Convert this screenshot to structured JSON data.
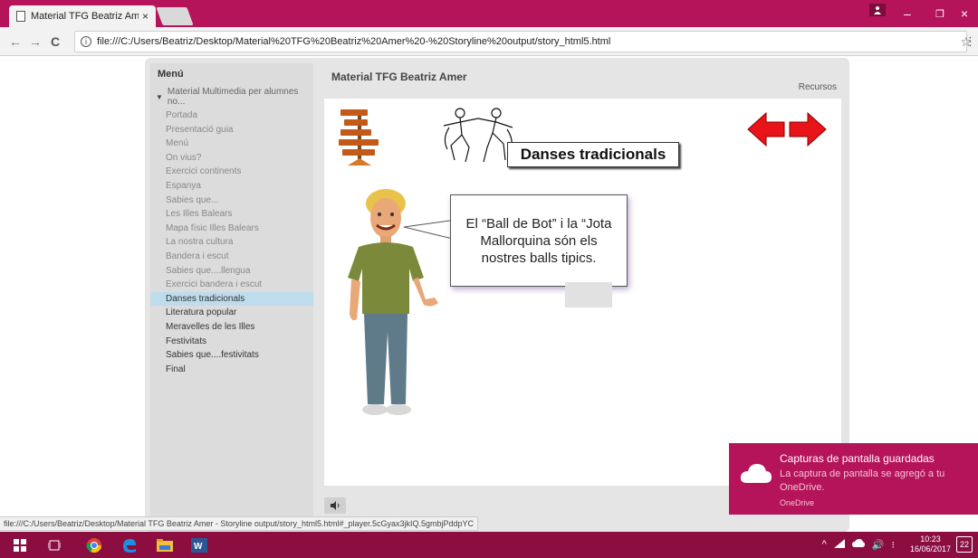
{
  "browser": {
    "tab_title": "Material TFG Beatriz Ame",
    "tab_close": "×",
    "url": "file:///C:/Users/Beatriz/Desktop/Material%20TFG%20Beatriz%20Amer%20-%20Storyline%20output/story_html5.html",
    "back": "←",
    "forward": "→",
    "reload": "C",
    "info": "i",
    "star": "☆",
    "menu_dots": "⋮",
    "minimize": "–",
    "restore": "❐",
    "close": "×"
  },
  "player": {
    "menu_heading": "Menú",
    "section_label": "Material Multimedia per alumnes no...",
    "menu_items": [
      {
        "label": "Portada",
        "state": "normal"
      },
      {
        "label": "Presentació guia",
        "state": "normal"
      },
      {
        "label": "Menú",
        "state": "normal"
      },
      {
        "label": "On vius?",
        "state": "normal"
      },
      {
        "label": "Exercici continents",
        "state": "normal"
      },
      {
        "label": "Espanya",
        "state": "normal"
      },
      {
        "label": "Sabies que...",
        "state": "normal"
      },
      {
        "label": "Les Illes Balears",
        "state": "normal"
      },
      {
        "label": "Mapa físic Illes Balears",
        "state": "normal"
      },
      {
        "label": "La nostra cultura",
        "state": "normal"
      },
      {
        "label": "Bandera i escut",
        "state": "normal"
      },
      {
        "label": "Sabies que....llengua",
        "state": "normal"
      },
      {
        "label": "Exercici bandera i escut",
        "state": "normal"
      },
      {
        "label": "Danses tradicionals",
        "state": "active"
      },
      {
        "label": "Literatura popular",
        "state": "visited"
      },
      {
        "label": "Meravelles de les Illes",
        "state": "visited"
      },
      {
        "label": "Festivitats",
        "state": "visited"
      },
      {
        "label": "Sabies que....festivitats",
        "state": "visited"
      },
      {
        "label": "Final",
        "state": "visited"
      }
    ],
    "course_title": "Material TFG Beatriz Amer",
    "resources_label": "Recursos",
    "slide": {
      "title": "Danses tradicionals",
      "bubble_text": "El “Ball de Bot” i la “Jota Mallorquina són els nostres balls tipics.",
      "sign_boards": [
        "",
        "",
        "",
        "",
        ""
      ]
    },
    "sound_icon": "🔈"
  },
  "status_url": "file:///C:/Users/Beatriz/Desktop/Material TFG Beatriz Amer - Storyline output/story_html5.html#_player.5cGyax3jkIQ.5gmbjPddpYC",
  "toast": {
    "title": "Capturas de pantalla guardadas",
    "body": "La captura de pantalla se agregó a tu OneDrive.",
    "source": "OneDrive"
  },
  "taskbar": {
    "time": "10:23",
    "date": "16/06/2017",
    "notification_count": "22",
    "tray_chevron": "^",
    "volume": "🔊",
    "lang": "⁝"
  },
  "colors": {
    "accent": "#b5135a",
    "taskbar": "#8c0d40",
    "menu_active": "#bddcec",
    "arrow_red": "#e8141a"
  }
}
